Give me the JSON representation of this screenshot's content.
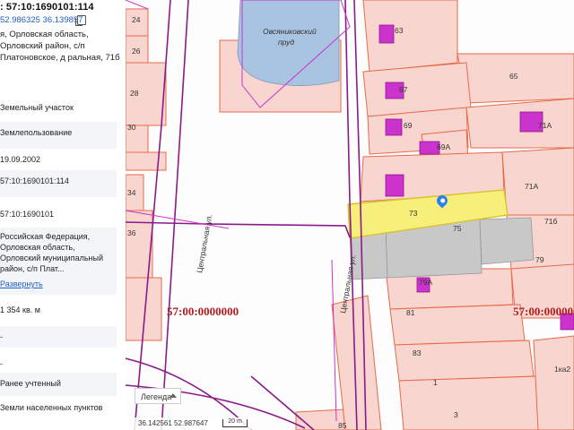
{
  "panel": {
    "cad_number": ": 57:10:1690101:114",
    "coords": "52.986325 36.139857",
    "address": "я, Орловская область, Орловский район, с/п Платоновское, д ральная, 71б",
    "rows": [
      {
        "text": "Земельный участок"
      },
      {
        "text": "Землепользование"
      },
      {
        "text": "19.09.2002"
      },
      {
        "text": "57:10:1690101:114"
      },
      {
        "text": "57:10:1690101"
      },
      {
        "text": "Российская Федерация, Орловская область, Орловский муниципальный район, с/п Плат..."
      },
      {
        "text": "Развернуть"
      },
      {
        "text": "1 354 кв. м"
      },
      {
        "text": "-"
      },
      {
        "text": "-"
      },
      {
        "text": "Ранее учтенный"
      },
      {
        "text": "Земли населенных пунктов"
      }
    ]
  },
  "map": {
    "pond_label_1": "Овсяниковский",
    "pond_label_2": "пруд",
    "street_1": "Центральная ул.",
    "street_2": "Центральная ул.",
    "quarter_1": "57:00:0000000",
    "quarter_2": "57:00:0000000",
    "parcels": [
      "24",
      "26",
      "28",
      "30",
      "34",
      "36",
      "63",
      "65",
      "67",
      "69",
      "69А",
      "71А",
      "71А",
      "73",
      "75",
      "71б",
      "79",
      "79А",
      "81",
      "83",
      "1",
      "3",
      "1ка2",
      "85",
      "8"
    ],
    "legend": "Легенда",
    "status_coords": "36.142561  52.987647",
    "scale": "20 m",
    "colors": {
      "selected": "#f6ef7a",
      "building": "#cc33cc",
      "boundary": "#8a1a8a",
      "parcel_fill": "#f9d5cf",
      "parcel_line": "#e66a4a",
      "water": "#a8c4e0",
      "grey": "#c8c8c8"
    }
  }
}
